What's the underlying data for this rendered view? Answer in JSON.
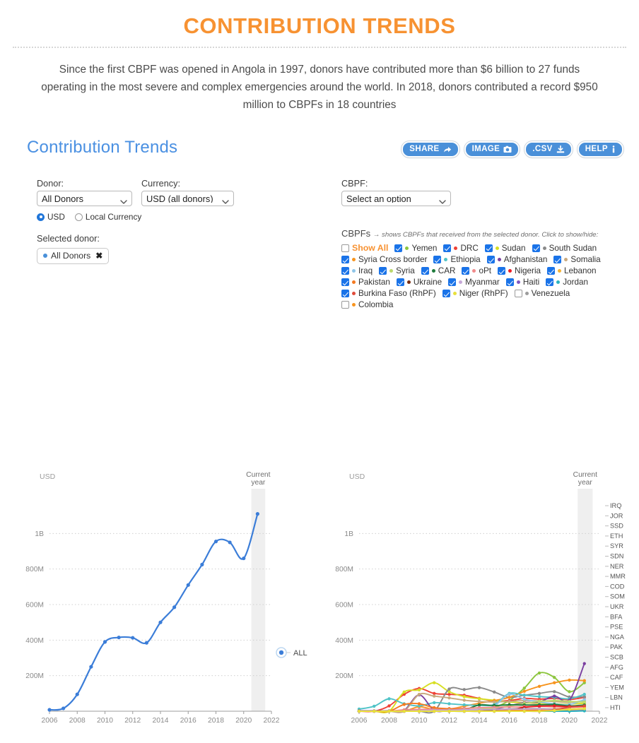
{
  "banner": {
    "title": "CONTRIBUTION TRENDS",
    "subtitle": "Since the first CBPF was opened in Angola in 1997, donors have contributed more than $6 billion to 27 funds operating in the most severe and complex emergencies around the world. In 2018, donors contributed a record $950 million to CBPFs in 18 countries"
  },
  "widget": {
    "title": "Contribution Trends"
  },
  "toolbar": {
    "share_label": "SHARE",
    "image_label": "IMAGE",
    "csv_label": ".CSV",
    "help_label": "HELP"
  },
  "controls": {
    "donor_label": "Donor:",
    "donor_value": "All Donors",
    "currency_label": "Currency:",
    "currency_value": "USD (all donors)",
    "cbpf_label": "CBPF:",
    "cbpf_value": "Select an option",
    "radio_usd": "USD",
    "radio_local": "Local Currency",
    "radio_selected": "USD",
    "selected_donor_label": "Selected donor:",
    "selected_donor_chip": "All Donors",
    "chip_close": "✖"
  },
  "legend": {
    "title": "CBPFs",
    "hint": "→ shows CBPFs that received from the selected donor. Click to show/hide:",
    "rows": [
      [
        {
          "label": "Show All",
          "checked": false,
          "color": null,
          "showall": true
        },
        {
          "label": "Yemen",
          "checked": true,
          "color": "#8DC63F"
        },
        {
          "label": "DRC",
          "checked": true,
          "color": "#EF4136"
        },
        {
          "label": "Sudan",
          "checked": true,
          "color": "#D7DF23"
        },
        {
          "label": "South Sudan",
          "checked": true,
          "color": "#8A8A8A"
        }
      ],
      [
        {
          "label": "Syria Cross border",
          "checked": true,
          "color": "#F7941E"
        },
        {
          "label": "Ethiopia",
          "checked": true,
          "color": "#4FC3C7"
        },
        {
          "label": "Afghanistan",
          "checked": true,
          "color": "#7B3FA0"
        },
        {
          "label": "Somalia",
          "checked": true,
          "color": "#C8A97E"
        }
      ],
      [
        {
          "label": "Iraq",
          "checked": true,
          "color": "#8FC5E8"
        },
        {
          "label": "Syria",
          "checked": true,
          "color": "#BBD86B"
        },
        {
          "label": "CAR",
          "checked": true,
          "color": "#1E7B3C"
        },
        {
          "label": "oPt",
          "checked": true,
          "color": "#F08A8A"
        },
        {
          "label": "Nigeria",
          "checked": true,
          "color": "#ED1C24"
        },
        {
          "label": "Lebanon",
          "checked": true,
          "color": "#F5B335"
        }
      ],
      [
        {
          "label": "Pakistan",
          "checked": true,
          "color": "#F47920"
        },
        {
          "label": "Ukraine",
          "checked": true,
          "color": "#7A2E12"
        },
        {
          "label": "Myanmar",
          "checked": true,
          "color": "#C6A8D8"
        },
        {
          "label": "Haiti",
          "checked": true,
          "color": "#7E57C2"
        },
        {
          "label": "Jordan",
          "checked": true,
          "color": "#2BB3C0"
        }
      ],
      [
        {
          "label": "Burkina Faso (RhPF)",
          "checked": true,
          "color": "#E04B3A"
        },
        {
          "label": "Niger (RhPF)",
          "checked": true,
          "color": "#E8E03C"
        },
        {
          "label": "Venezuela",
          "checked": false,
          "color": "#9C9C9C"
        }
      ],
      [
        {
          "label": "Colombia",
          "checked": false,
          "color": "#F7941E"
        }
      ]
    ]
  },
  "chart_data": [
    {
      "type": "line",
      "name": "total-contributions",
      "title": "",
      "xlabel": "",
      "ylabel": "USD",
      "axis_unit": "USD",
      "current_year_label": "Current year",
      "current_year": 2021,
      "series_label": "ALL",
      "line_color": "#3B7DD8",
      "grid": true,
      "xlim": [
        2006,
        2022
      ],
      "ylim": [
        0,
        1200000000
      ],
      "ytick_values": [
        200000000,
        400000000,
        600000000,
        800000000,
        1000000000
      ],
      "ytick_labels": [
        "200M",
        "400M",
        "600M",
        "800M",
        "1B"
      ],
      "xtick_labels": [
        "2006",
        "2008",
        "2010",
        "2012",
        "2014",
        "2016",
        "2018",
        "2020",
        "2022"
      ],
      "x": [
        2006,
        2007,
        2008,
        2009,
        2010,
        2011,
        2012,
        2013,
        2014,
        2015,
        2016,
        2017,
        2018,
        2019,
        2020,
        2021
      ],
      "values": [
        8000000,
        16000000,
        95000000,
        250000000,
        390000000,
        415000000,
        413000000,
        385000000,
        500000000,
        585000000,
        710000000,
        825000000,
        955000000,
        950000000,
        860000000,
        1110000000
      ]
    },
    {
      "type": "line",
      "name": "contributions-by-cbpf",
      "title": "",
      "xlabel": "",
      "ylabel": "USD",
      "axis_unit": "USD",
      "current_year_label": "Current year",
      "current_year": 2021,
      "grid": true,
      "xlim": [
        2006,
        2022
      ],
      "ylim": [
        0,
        1200000000
      ],
      "ytick_values": [
        200000000,
        400000000,
        600000000,
        800000000,
        1000000000
      ],
      "ytick_labels": [
        "200M",
        "400M",
        "600M",
        "800M",
        "1B"
      ],
      "xtick_labels": [
        "2006",
        "2008",
        "2010",
        "2012",
        "2014",
        "2016",
        "2018",
        "2020",
        "2022"
      ],
      "right_labels": [
        "IRQ",
        "JOR",
        "SSD",
        "ETH",
        "SYR",
        "SDN",
        "NER",
        "MMR",
        "COD",
        "SOM",
        "UKR",
        "BFA",
        "PSE",
        "NGA",
        "PAK",
        "SCB",
        "AFG",
        "CAF",
        "YEM",
        "LBN",
        "HTI"
      ],
      "x": [
        2006,
        2007,
        2008,
        2009,
        2010,
        2011,
        2012,
        2013,
        2014,
        2015,
        2016,
        2017,
        2018,
        2019,
        2020,
        2021
      ],
      "series": [
        {
          "name": "Yemen",
          "color": "#8DC63F",
          "values": [
            0,
            0,
            0,
            0,
            0,
            0,
            0,
            0,
            8000000,
            22000000,
            60000000,
            130000000,
            215000000,
            190000000,
            110000000,
            160000000
          ]
        },
        {
          "name": "DRC",
          "color": "#EF4136",
          "values": [
            0,
            0,
            30000000,
            95000000,
            128000000,
            100000000,
            95000000,
            90000000,
            72000000,
            58000000,
            60000000,
            72000000,
            68000000,
            72000000,
            65000000,
            78000000
          ]
        },
        {
          "name": "Sudan",
          "color": "#D7DF23",
          "values": [
            0,
            0,
            0,
            108000000,
            120000000,
            160000000,
            110000000,
            82000000,
            70000000,
            62000000,
            52000000,
            47000000,
            45000000,
            42000000,
            40000000,
            45000000
          ]
        },
        {
          "name": "South Sudan",
          "color": "#8A8A8A",
          "values": [
            0,
            0,
            0,
            0,
            0,
            0,
            125000000,
            122000000,
            133000000,
            108000000,
            78000000,
            90000000,
            100000000,
            110000000,
            80000000,
            82000000
          ]
        },
        {
          "name": "Syria Cross border",
          "color": "#F7941E",
          "values": [
            0,
            0,
            0,
            0,
            25000000,
            10000000,
            12000000,
            28000000,
            45000000,
            60000000,
            78000000,
            112000000,
            140000000,
            160000000,
            175000000,
            172000000
          ]
        },
        {
          "name": "Ethiopia",
          "color": "#4FC3C7",
          "values": [
            12000000,
            28000000,
            70000000,
            42000000,
            30000000,
            48000000,
            42000000,
            36000000,
            33000000,
            38000000,
            100000000,
            90000000,
            82000000,
            78000000,
            70000000,
            95000000
          ]
        },
        {
          "name": "Afghanistan",
          "color": "#7B3FA0",
          "values": [
            2000000,
            2000000,
            2000000,
            5000000,
            92000000,
            5000000,
            4000000,
            5000000,
            8000000,
            12000000,
            30000000,
            48000000,
            52000000,
            85000000,
            62000000,
            268000000
          ]
        },
        {
          "name": "Somalia",
          "color": "#C8A97E",
          "values": [
            0,
            0,
            0,
            0,
            95000000,
            85000000,
            75000000,
            62000000,
            55000000,
            52000000,
            55000000,
            60000000,
            58000000,
            55000000,
            50000000,
            58000000
          ]
        },
        {
          "name": "Iraq",
          "color": "#8FC5E8",
          "values": [
            0,
            0,
            0,
            0,
            0,
            0,
            0,
            0,
            10000000,
            30000000,
            95000000,
            68000000,
            52000000,
            42000000,
            38000000,
            65000000
          ]
        },
        {
          "name": "Syria",
          "color": "#BBD86B",
          "values": [
            0,
            0,
            0,
            0,
            0,
            0,
            0,
            5000000,
            12000000,
            18000000,
            30000000,
            44000000,
            55000000,
            60000000,
            55000000,
            52000000
          ]
        },
        {
          "name": "CAR",
          "color": "#1E7B3C",
          "values": [
            0,
            0,
            0,
            2000000,
            4000000,
            5000000,
            5000000,
            8000000,
            35000000,
            32000000,
            36000000,
            35000000,
            36000000,
            38000000,
            30000000,
            35000000
          ]
        },
        {
          "name": "oPt",
          "color": "#F08A8A",
          "values": [
            0,
            0,
            0,
            8000000,
            10000000,
            12000000,
            14000000,
            16000000,
            20000000,
            22000000,
            24000000,
            26000000,
            28000000,
            25000000,
            22000000,
            24000000
          ]
        },
        {
          "name": "Nigeria",
          "color": "#ED1C24",
          "values": [
            0,
            0,
            0,
            0,
            0,
            0,
            0,
            0,
            0,
            0,
            5000000,
            22000000,
            28000000,
            30000000,
            26000000,
            28000000
          ]
        },
        {
          "name": "Lebanon",
          "color": "#F5B335",
          "values": [
            0,
            0,
            0,
            0,
            0,
            0,
            0,
            0,
            0,
            0,
            0,
            6000000,
            10000000,
            14000000,
            12000000,
            14000000
          ]
        },
        {
          "name": "Pakistan",
          "color": "#F47920",
          "values": [
            0,
            0,
            0,
            38000000,
            42000000,
            20000000,
            14000000,
            10000000,
            8000000,
            6000000,
            5000000,
            5000000,
            5000000,
            6000000,
            8000000,
            10000000
          ]
        },
        {
          "name": "Ukraine",
          "color": "#7A2E12",
          "values": [
            0,
            0,
            0,
            0,
            0,
            0,
            0,
            0,
            0,
            8000000,
            12000000,
            14000000,
            14000000,
            12000000,
            10000000,
            12000000
          ]
        },
        {
          "name": "Myanmar",
          "color": "#C6A8D8",
          "values": [
            0,
            0,
            0,
            0,
            4000000,
            5000000,
            6000000,
            8000000,
            9000000,
            10000000,
            11000000,
            12000000,
            13000000,
            12000000,
            10000000,
            11000000
          ]
        },
        {
          "name": "Haiti",
          "color": "#7E57C2",
          "values": [
            0,
            0,
            0,
            0,
            0,
            0,
            0,
            0,
            0,
            0,
            0,
            0,
            0,
            0,
            0,
            3000000
          ]
        },
        {
          "name": "Jordan",
          "color": "#2BB3C0",
          "values": [
            0,
            0,
            0,
            0,
            0,
            0,
            0,
            0,
            0,
            0,
            0,
            0,
            0,
            0,
            0,
            2000000
          ]
        },
        {
          "name": "Burkina Faso (RhPF)",
          "color": "#E04B3A",
          "values": [
            0,
            0,
            0,
            0,
            0,
            0,
            0,
            0,
            0,
            0,
            0,
            0,
            0,
            8000000,
            22000000,
            30000000
          ]
        },
        {
          "name": "Niger (RhPF)",
          "color": "#E8E03C",
          "values": [
            0,
            0,
            0,
            0,
            0,
            0,
            0,
            0,
            0,
            0,
            0,
            0,
            0,
            4000000,
            10000000,
            14000000
          ]
        }
      ]
    }
  ]
}
